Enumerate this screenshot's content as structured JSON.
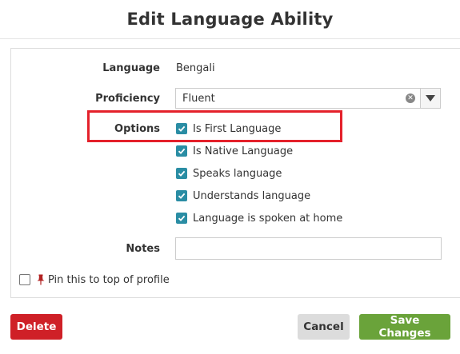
{
  "modal": {
    "title": "Edit Language Ability"
  },
  "form": {
    "language": {
      "label": "Language",
      "value": "Bengali"
    },
    "proficiency": {
      "label": "Proficiency",
      "value": "Fluent"
    },
    "options": {
      "label": "Options",
      "items": [
        {
          "label": "Is First Language",
          "checked": true
        },
        {
          "label": "Is Native Language",
          "checked": true
        },
        {
          "label": "Speaks language",
          "checked": true
        },
        {
          "label": "Understands language",
          "checked": true
        },
        {
          "label": "Language is spoken at home",
          "checked": true
        }
      ]
    },
    "notes": {
      "label": "Notes",
      "value": ""
    },
    "pin": {
      "label": "Pin this to top of profile",
      "checked": false
    }
  },
  "footer": {
    "delete_label": "Delete",
    "cancel_label": "Cancel",
    "save_label": "Save Changes"
  },
  "colors": {
    "accent_checkbox": "#2a8da4",
    "delete": "#cf2027",
    "save": "#6aa33a",
    "cancel": "#dcdcdc",
    "highlight": "#e4212b"
  }
}
